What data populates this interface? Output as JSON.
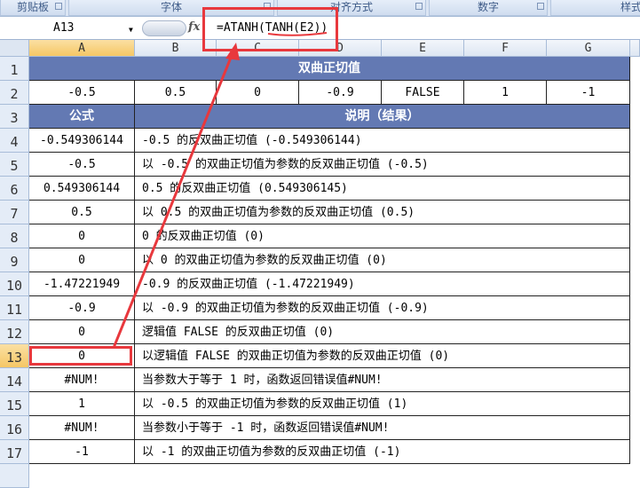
{
  "ribbon": {
    "groups": [
      "剪贴板",
      "字体",
      "对齐方式",
      "数字",
      "样式"
    ]
  },
  "formula_bar": {
    "name_box": "A13",
    "fx": "fx",
    "formula": "=ATANH(TANH(E2))"
  },
  "columns": [
    "A",
    "B",
    "C",
    "D",
    "E",
    "F",
    "G"
  ],
  "rows": [
    "1",
    "2",
    "3",
    "4",
    "5",
    "6",
    "7",
    "8",
    "9",
    "10",
    "11",
    "12",
    "13",
    "14",
    "15",
    "16",
    "17"
  ],
  "sheet": {
    "title": "双曲正切值",
    "values": [
      "-0.5",
      "0.5",
      "0",
      "-0.9",
      "FALSE",
      "1",
      "-1"
    ],
    "header_formula": "公式",
    "header_desc": "说明（结果）",
    "data": [
      {
        "a": "-0.549306144",
        "b": "-0.5 的反双曲正切值 (-0.549306144)"
      },
      {
        "a": "-0.5",
        "b": "以 -0.5 的双曲正切值为参数的反双曲正切值 (-0.5)"
      },
      {
        "a": "0.549306144",
        "b": "0.5 的反双曲正切值 (0.549306145)"
      },
      {
        "a": "0.5",
        "b": "以 0.5 的双曲正切值为参数的反双曲正切值 (0.5)"
      },
      {
        "a": "0",
        "b": "0 的反双曲正切值 (0)"
      },
      {
        "a": "0",
        "b": "以 0 的双曲正切值为参数的反双曲正切值 (0)"
      },
      {
        "a": "-1.47221949",
        "b": "-0.9 的反双曲正切值 (-1.47221949)"
      },
      {
        "a": "-0.9",
        "b": "以 -0.9 的双曲正切值为参数的反双曲正切值 (-0.9)"
      },
      {
        "a": "0",
        "b": "逻辑值 FALSE 的反双曲正切值 (0)"
      },
      {
        "a": "0",
        "b": "以逻辑值 FALSE 的双曲正切值为参数的反双曲正切值 (0)"
      },
      {
        "a": "#NUM!",
        "b": "当参数大于等于 1 时，函数返回错误值#NUM!"
      },
      {
        "a": "1",
        "b": "以 -0.5 的双曲正切值为参数的反双曲正切值 (1)"
      },
      {
        "a": "#NUM!",
        "b": "当参数小于等于 -1 时，函数返回错误值#NUM!"
      },
      {
        "a": "-1",
        "b": "以 -1 的双曲正切值为参数的反双曲正切值 (-1)"
      }
    ]
  },
  "colors": {
    "header_fill": "#6379b3",
    "annotation": "#e8383d",
    "selected": "#f5c765"
  }
}
